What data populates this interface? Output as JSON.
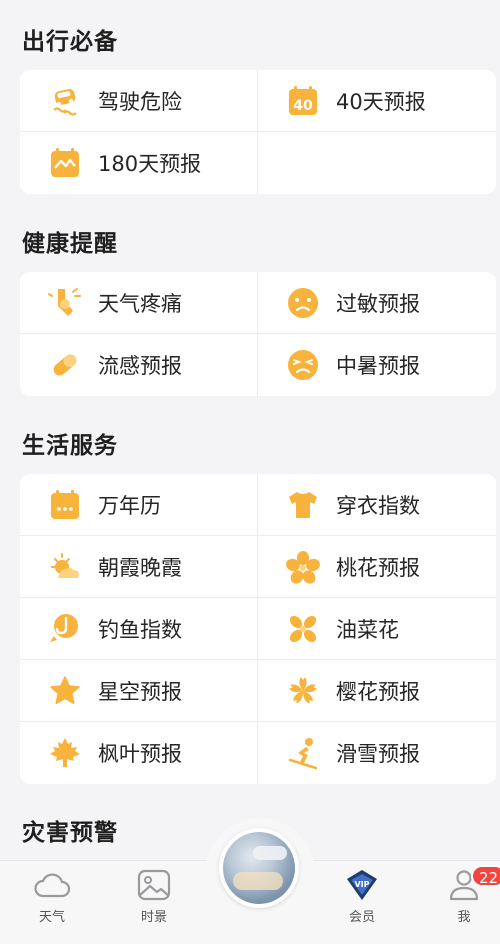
{
  "sections": [
    {
      "title": "出行必备",
      "rows": [
        [
          {
            "label": "驾驶危险",
            "icon": "car-skid-icon"
          },
          {
            "label": "40天预报",
            "icon": "calendar-40-icon"
          }
        ],
        [
          {
            "label": "180天预报",
            "icon": "calendar-wave-icon"
          },
          null
        ]
      ]
    },
    {
      "title": "健康提醒",
      "rows": [
        [
          {
            "label": "天气疼痛",
            "icon": "joint-pain-icon"
          },
          {
            "label": "过敏预报",
            "icon": "allergy-face-icon"
          }
        ],
        [
          {
            "label": "流感预报",
            "icon": "pill-icon"
          },
          {
            "label": "中暑预报",
            "icon": "heatstroke-face-icon"
          }
        ]
      ]
    },
    {
      "title": "生活服务",
      "rows": [
        [
          {
            "label": "万年历",
            "icon": "calendar-icon"
          },
          {
            "label": "穿衣指数",
            "icon": "tshirt-icon"
          }
        ],
        [
          {
            "label": "朝霞晚霞",
            "icon": "sunrise-icon"
          },
          {
            "label": "桃花预报",
            "icon": "peach-blossom-icon"
          }
        ],
        [
          {
            "label": "钓鱼指数",
            "icon": "fishing-icon"
          },
          {
            "label": "油菜花",
            "icon": "rapeseed-flower-icon"
          }
        ],
        [
          {
            "label": "星空预报",
            "icon": "star-icon"
          },
          {
            "label": "樱花预报",
            "icon": "cherry-blossom-icon"
          }
        ],
        [
          {
            "label": "枫叶预报",
            "icon": "maple-leaf-icon"
          },
          {
            "label": "滑雪预报",
            "icon": "skiing-icon"
          }
        ]
      ]
    },
    {
      "title": "灾害预警",
      "rows": []
    }
  ],
  "tabbar": {
    "weather": "天气",
    "scenery": "时景",
    "member": "会员",
    "vip_badge": "VIP",
    "me": "我",
    "me_badge": "22"
  },
  "colors": {
    "accent": "#f7b33b",
    "badge": "#f2453d"
  }
}
